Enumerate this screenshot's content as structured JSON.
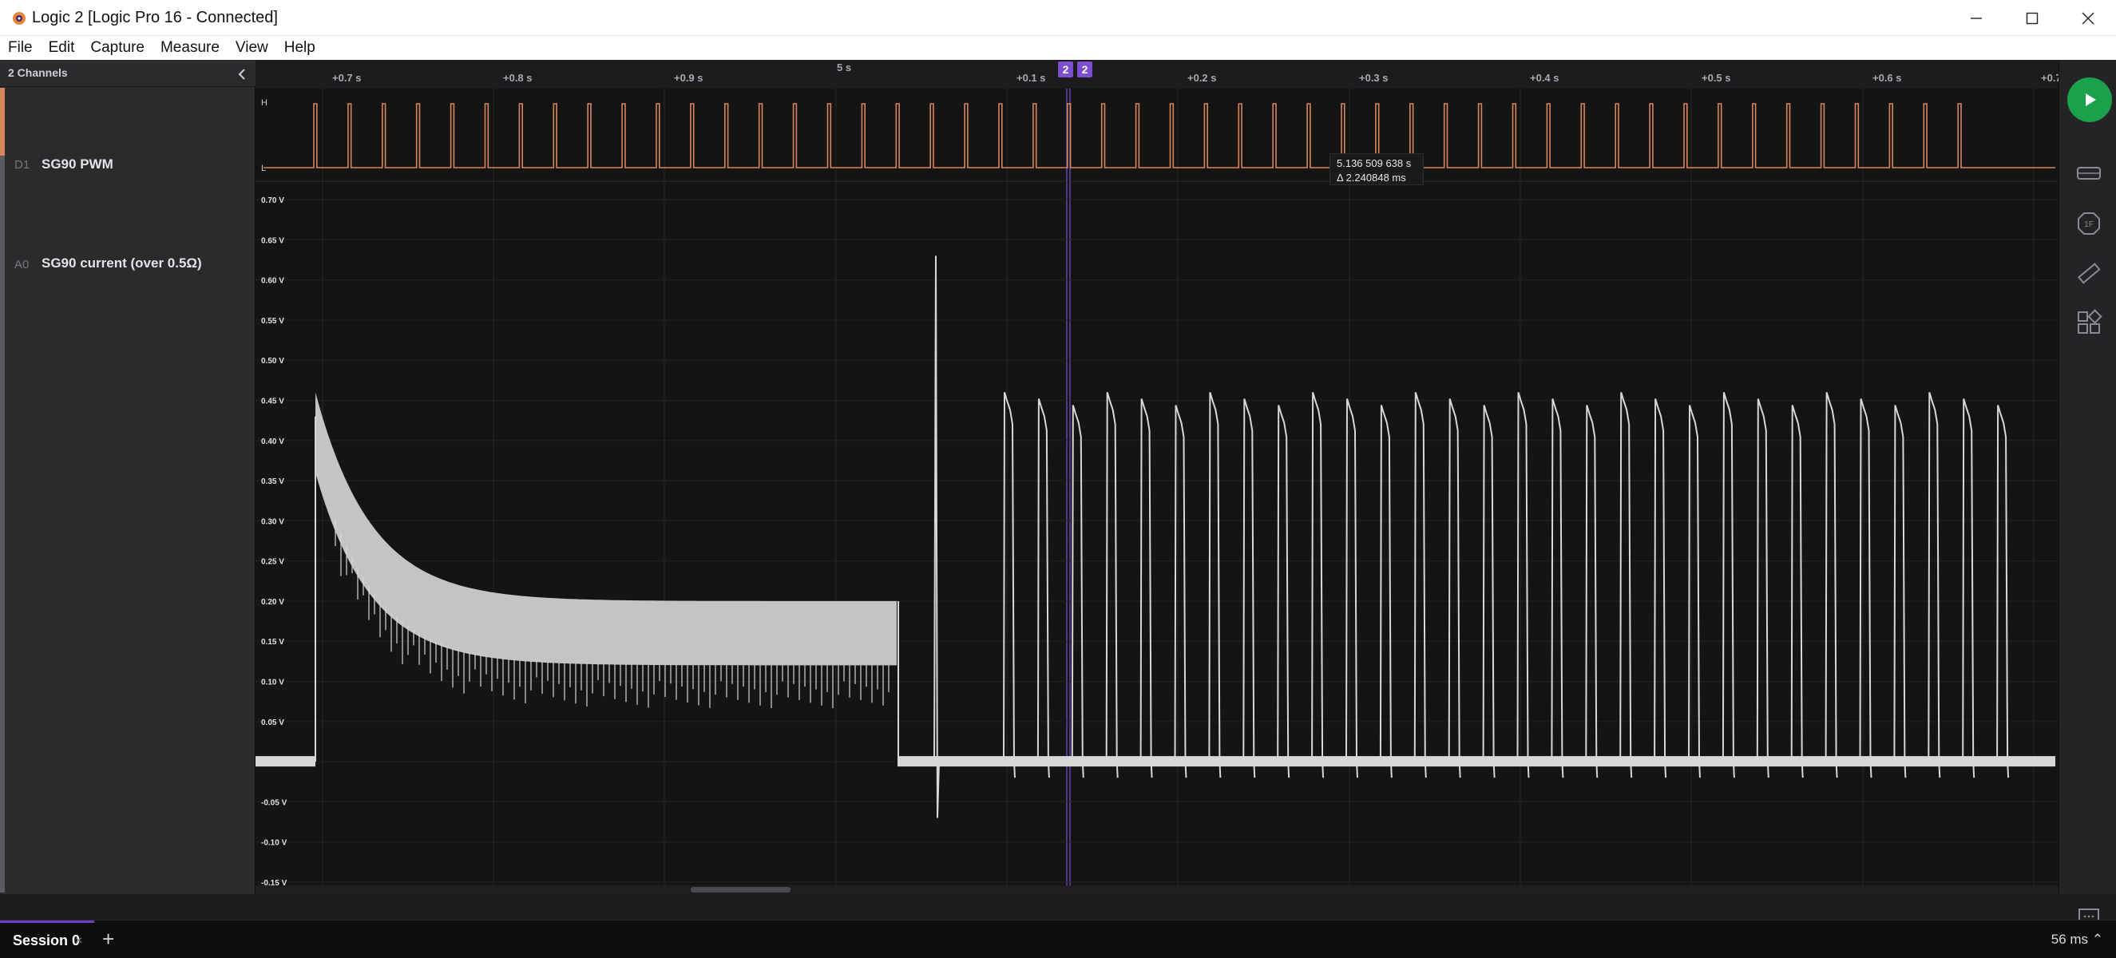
{
  "window": {
    "title": "Logic 2 [Logic Pro 16 - Connected]"
  },
  "menu": [
    "File",
    "Edit",
    "Capture",
    "Measure",
    "View",
    "Help"
  ],
  "sidebar": {
    "header": "2 Channels",
    "channels": [
      {
        "id": "D1",
        "name": "SG90 PWM",
        "color": "#d9855a"
      },
      {
        "id": "A0",
        "name": "SG90 current (over 0.5Ω)",
        "color": "#6b6b70"
      }
    ]
  },
  "timeline": {
    "center_label": "5 s",
    "ticks": [
      "+0.7 s",
      "+0.8 s",
      "+0.9 s",
      "+0.1 s",
      "+0.2 s",
      "+0.3 s",
      "+0.4 s",
      "+0.5 s",
      "+0.6 s",
      "+0.7"
    ],
    "markers": [
      "2",
      "2"
    ],
    "marker_color": "#7b4fd0"
  },
  "digital": {
    "high_label": "H",
    "low_label": "L",
    "pulse_count": 49
  },
  "cursor": {
    "time": "5.136 509 638 s",
    "delta": "Δ 2.240848 ms"
  },
  "chart_data": {
    "type": "line",
    "title": "",
    "ylabel": "",
    "y_ticks": [
      "0.70 V",
      "0.65 V",
      "0.60 V",
      "0.55 V",
      "0.50 V",
      "0.45 V",
      "0.40 V",
      "0.35 V",
      "0.30 V",
      "0.25 V",
      "0.20 V",
      "0.15 V",
      "0.10 V",
      "0.05 V",
      "0.00 V",
      "-0.05 V",
      "-0.10 V",
      "-0.15 V"
    ],
    "ylim": [
      -0.15,
      0.7
    ],
    "grid": true,
    "series": [
      {
        "name": "SG90 current (over 0.5Ω)",
        "phases": [
          {
            "description_time": "start",
            "value": 0.0
          },
          {
            "startup_peak": 0.43,
            "settled": 0.17
          },
          {
            "spike_peak": 0.63,
            "spike_min": -0.07
          },
          {
            "pulse_peak": 0.46,
            "pulse_count": 30
          }
        ]
      }
    ],
    "color": "#d7d7d7"
  },
  "bottom": {
    "session_label": "Session 0",
    "close_glyph": "×",
    "add_glyph": "+",
    "status": "56 ms ⌃"
  },
  "icons": {
    "minimize": "minimize-icon",
    "maximize": "maximize-icon",
    "close": "close-icon",
    "play": "play-icon",
    "analyzers": "analyzers-icon",
    "triggers": "trigger-icon",
    "measure": "ruler-icon",
    "extensions": "extensions-icon",
    "feedback": "chat-icon",
    "menu": "hamburger-icon"
  }
}
